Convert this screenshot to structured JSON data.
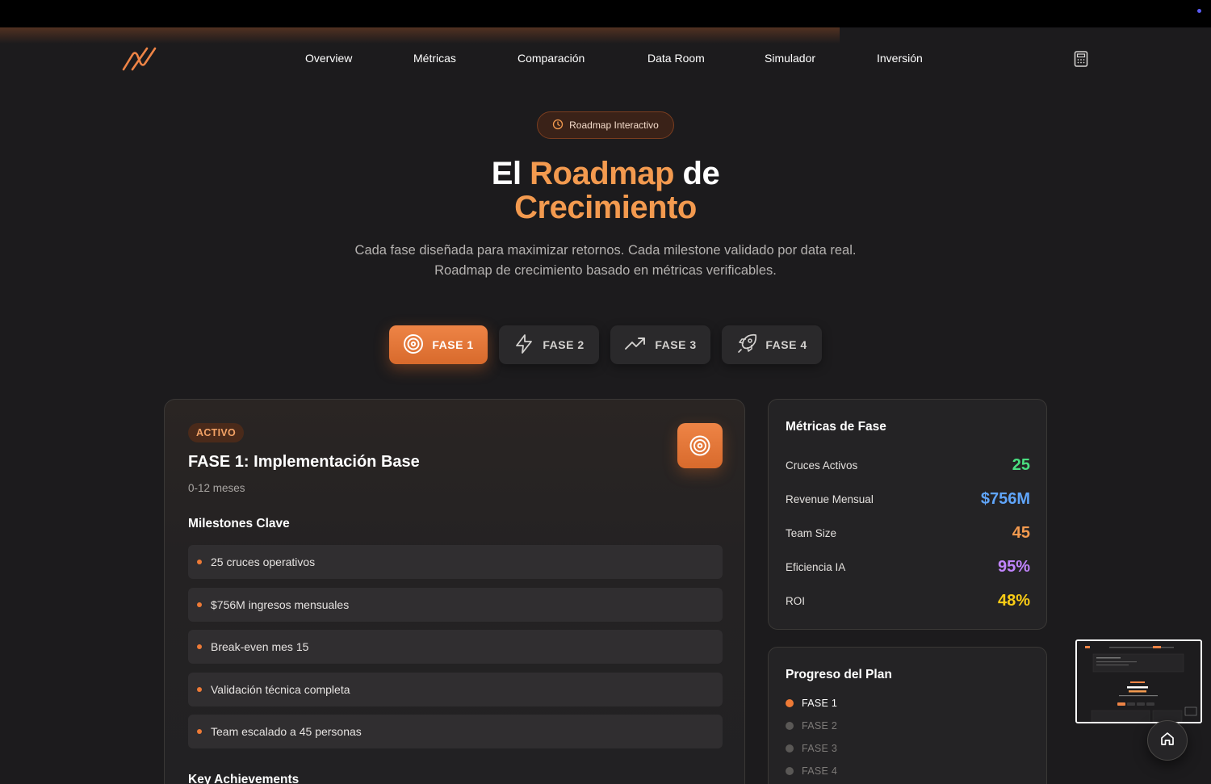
{
  "nav": {
    "items": [
      "Overview",
      "Métricas",
      "Comparación",
      "Data Room",
      "Simulador",
      "Inversión"
    ],
    "logo_icon": "logo-icon",
    "calculator_icon": "calculator-icon"
  },
  "hero": {
    "badge": "Roadmap Interactivo",
    "title_part1": "El ",
    "title_accent1": "Roadmap",
    "title_part2": " de",
    "title_accent2": "Crecimiento",
    "subtitle_line1": "Cada fase diseñada para maximizar retornos. Cada milestone validado por data real.",
    "subtitle_line2": "Roadmap de crecimiento basado en métricas verificables."
  },
  "phase_tabs": [
    {
      "label": "FASE 1",
      "icon": "target-icon",
      "active": true
    },
    {
      "label": "FASE 2",
      "icon": "lightning-icon",
      "active": false
    },
    {
      "label": "FASE 3",
      "icon": "trending-up-icon",
      "active": false
    },
    {
      "label": "FASE 4",
      "icon": "rocket-icon",
      "active": false
    }
  ],
  "phase_card": {
    "status": "ACTIVO",
    "title": "FASE 1: Implementación Base",
    "duration": "0-12 meses",
    "milestones_title": "Milestones Clave",
    "milestones": [
      "25 cruces operativos",
      "$756M ingresos mensuales",
      "Break-even mes 15",
      "Validación técnica completa",
      "Team escalado a 45 personas"
    ],
    "achievements_title": "Key Achievements"
  },
  "metrics": {
    "title": "Métricas de Fase",
    "rows": [
      {
        "label": "Cruces Activos",
        "value": "25",
        "color": "#4ade80"
      },
      {
        "label": "Revenue Mensual",
        "value": "$756M",
        "color": "#60a5fa"
      },
      {
        "label": "Team Size",
        "value": "45",
        "color": "#f39a4f"
      },
      {
        "label": "Eficiencia IA",
        "value": "95%",
        "color": "#c084fc"
      },
      {
        "label": "ROI",
        "value": "48%",
        "color": "#facc15"
      }
    ]
  },
  "progress": {
    "title": "Progreso del Plan",
    "items": [
      {
        "label": "FASE 1",
        "active": true
      },
      {
        "label": "FASE 2",
        "active": false
      },
      {
        "label": "FASE 3",
        "active": false
      },
      {
        "label": "FASE 4",
        "active": false
      }
    ]
  },
  "colors": {
    "accent": "#ee8446",
    "background": "#1c1b1d"
  }
}
